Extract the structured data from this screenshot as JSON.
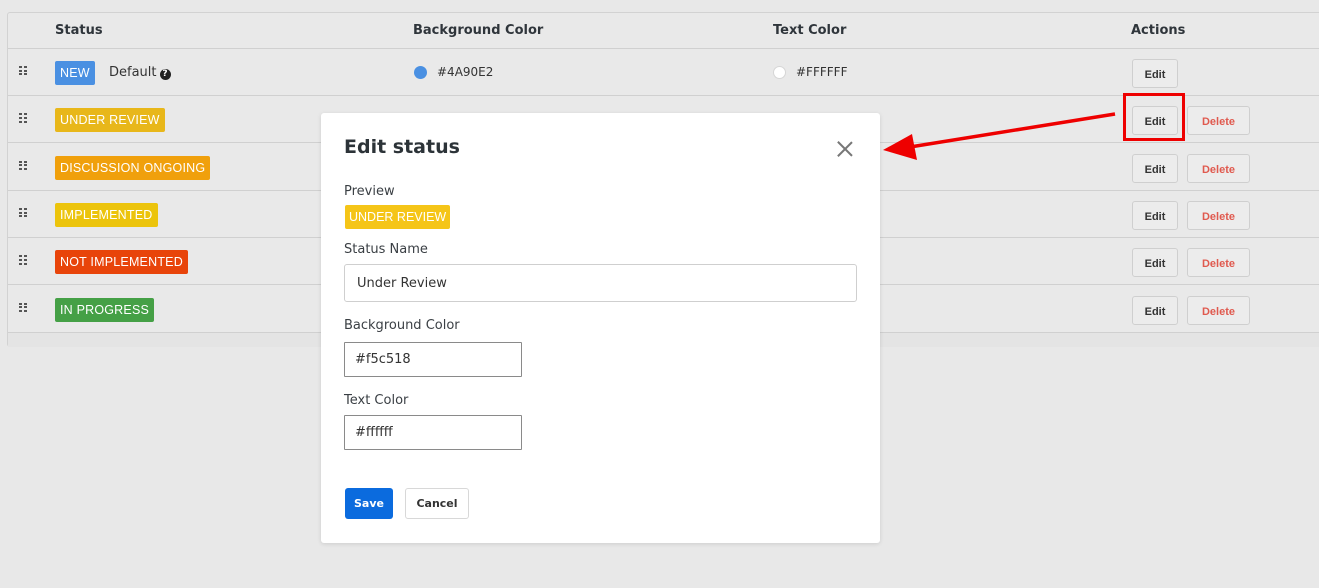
{
  "table": {
    "headers": {
      "status": "Status",
      "background_color": "Background Color",
      "text_color": "Text Color",
      "actions": "Actions"
    },
    "rows": [
      {
        "label": "NEW",
        "bg": "#4A90E2",
        "fg": "#FFFFFF",
        "is_default": true,
        "default_label": "Default",
        "bg_text": "#4A90E2",
        "fg_text": "#FFFFFF",
        "edit": "Edit"
      },
      {
        "label": "UNDER REVIEW",
        "bg": "#e8b71a",
        "fg": "#FFFFFF",
        "is_default": false,
        "edit": "Edit",
        "delete": "Delete"
      },
      {
        "label": "DISCUSSION ONGOING",
        "bg": "#f0a00c",
        "fg": "#FFFFFF",
        "is_default": false,
        "edit": "Edit",
        "delete": "Delete"
      },
      {
        "label": "IMPLEMENTED",
        "bg": "#ecc40c",
        "fg": "#FFFFFF",
        "is_default": false,
        "edit": "Edit",
        "delete": "Delete"
      },
      {
        "label": "NOT IMPLEMENTED",
        "bg": "#e8440a",
        "fg": "#FFFFFF",
        "is_default": false,
        "edit": "Edit",
        "delete": "Delete"
      },
      {
        "label": "IN PROGRESS",
        "bg": "#45a046",
        "fg": "#FFFFFF",
        "is_default": false,
        "edit": "Edit",
        "delete": "Delete"
      }
    ]
  },
  "modal": {
    "title": "Edit status",
    "preview_label": "Preview",
    "preview_badge": "UNDER REVIEW",
    "preview_bg": "#f5c518",
    "preview_fg": "#ffffff",
    "status_name_label": "Status Name",
    "status_name_value": "Under Review",
    "background_color_label": "Background Color",
    "background_color_value": "#f5c518",
    "text_color_label": "Text Color",
    "text_color_value": "#ffffff",
    "save_label": "Save",
    "cancel_label": "Cancel"
  },
  "annotation": {
    "color": "#ee0000",
    "target": "Edit button in UNDER REVIEW row"
  }
}
